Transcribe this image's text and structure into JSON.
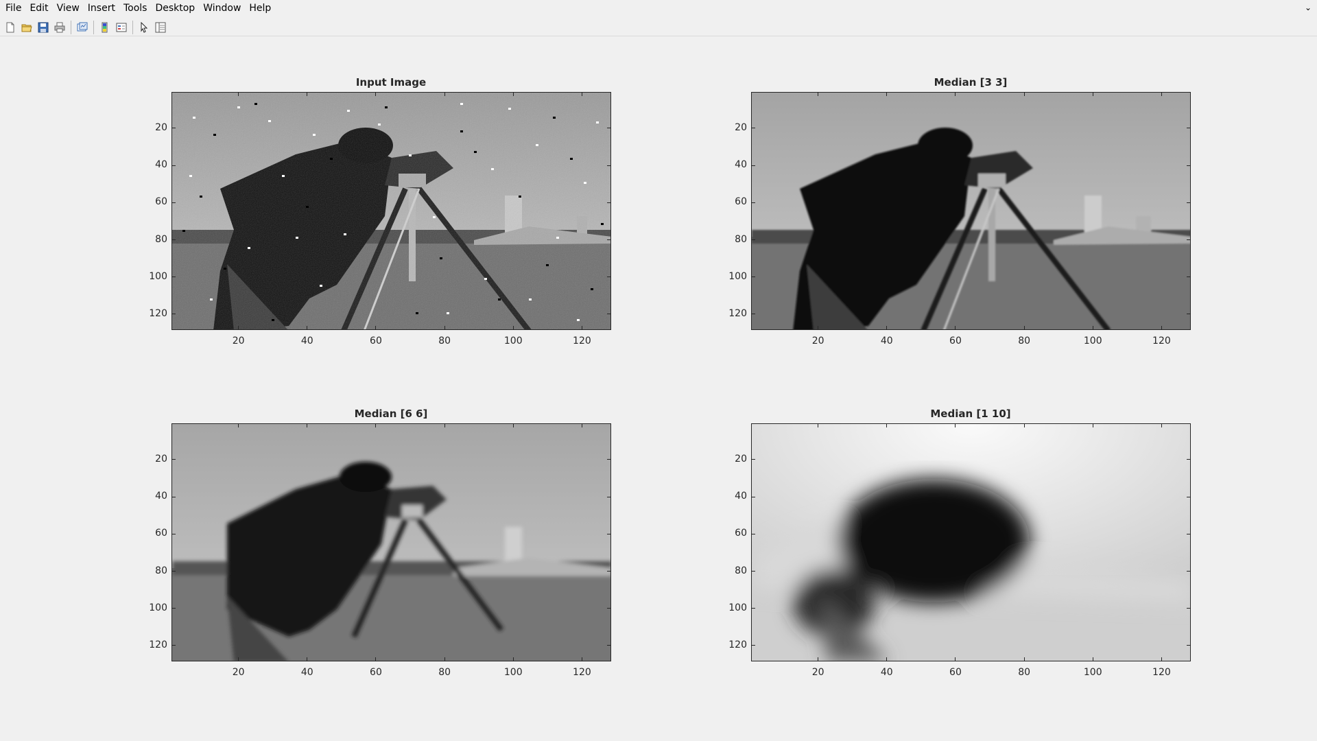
{
  "menu": [
    "File",
    "Edit",
    "View",
    "Insert",
    "Tools",
    "Desktop",
    "Window",
    "Help"
  ],
  "menu_corner": "⌄",
  "toolbar": {
    "icons": [
      "new-figure-icon",
      "open-file-icon",
      "save-icon",
      "print-icon",
      "link-plot-icon",
      "insert-colorbar-icon",
      "insert-legend-icon",
      "edit-plot-icon",
      "property-inspector-icon"
    ]
  },
  "colors": {
    "background": "#f0f0f0",
    "axes_color": "#262626"
  },
  "axes": [
    {
      "title": "Input Image",
      "image": "cameraman with salt-and-pepper noise",
      "xticks": [
        "20",
        "40",
        "60",
        "80",
        "100",
        "120"
      ],
      "yticks": [
        "20",
        "40",
        "60",
        "80",
        "100",
        "120"
      ]
    },
    {
      "title": "Median [3 3]",
      "image": "cameraman median filtered 3x3",
      "xticks": [
        "20",
        "40",
        "60",
        "80",
        "100",
        "120"
      ],
      "yticks": [
        "20",
        "40",
        "60",
        "80",
        "100",
        "120"
      ]
    },
    {
      "title": "Median [6 6]",
      "image": "cameraman median filtered 6x6",
      "xticks": [
        "20",
        "40",
        "60",
        "80",
        "100",
        "120"
      ],
      "yticks": [
        "20",
        "40",
        "60",
        "80",
        "100",
        "120"
      ]
    },
    {
      "title": "Median [1 10]",
      "image": "cameraman median filtered 1x10",
      "xticks": [
        "20",
        "40",
        "60",
        "80",
        "100",
        "120"
      ],
      "yticks": [
        "20",
        "40",
        "60",
        "80",
        "100",
        "120"
      ]
    }
  ]
}
